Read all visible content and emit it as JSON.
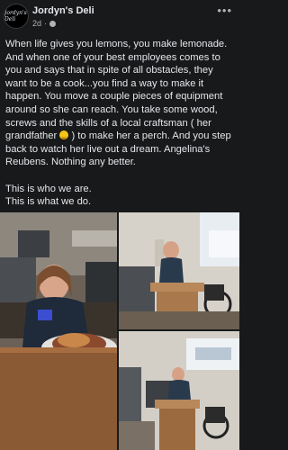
{
  "post": {
    "page_name": "Jordyn's Deli",
    "avatar_text": "Jordyn's Deli",
    "time": "2d",
    "more_label": "•••",
    "text_part1": "When life gives you lemons, you make lemonade. And when one of your best employees comes to you and says that in spite of all obstacles, they want to be a cook...you find a way to make it happen. You move a couple pieces of equipment around so she can reach. You take some wood, screws and the skills of a local craftsman ( her grandfather ",
    "text_part2": ") to make her a perch. And you step back to watch her live out a dream. Angelina's Reubens. Nothing any better.",
    "text_para2_line1": "This is who we are.",
    "text_para2_line2": "This is what we do.",
    "emoji_icon": "smiling-face-with-hearts"
  },
  "colors": {
    "background": "#18191a",
    "text": "#e4e6eb",
    "secondary_text": "#b0b3b8"
  }
}
